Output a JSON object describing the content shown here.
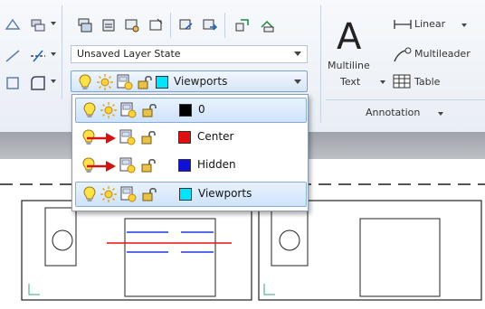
{
  "ribbon": {
    "layer_state": {
      "value": "Unsaved Layer State"
    },
    "current_layer": {
      "name": "Viewports",
      "color": "#00e5ff"
    },
    "annotation": {
      "multiline_text_line1": "Multiline",
      "multiline_text_line2": "Text",
      "linear_label": "Linear",
      "multileader_label": "Multileader",
      "table_label": "Table",
      "panel_title": "Annotation"
    }
  },
  "layer_dropdown": {
    "layers": [
      {
        "name": "0",
        "color": "#000000",
        "frozen": false,
        "highlighted": true
      },
      {
        "name": "Center",
        "color": "#e01010",
        "frozen": true,
        "highlighted": false
      },
      {
        "name": "Hidden",
        "color": "#1010d8",
        "frozen": true,
        "highlighted": false
      },
      {
        "name": "Viewports",
        "color": "#00e5ff",
        "frozen": false,
        "highlighted": true
      }
    ]
  },
  "icons": {
    "on_off": "lightbulb-icon",
    "freeze": "sun-icon",
    "viewport_freeze": "viewport-freeze-icon",
    "lock": "unlock-icon",
    "frozen_marker": "red-arrow-icon"
  }
}
